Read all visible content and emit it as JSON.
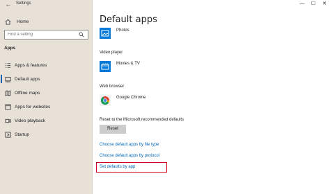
{
  "window": {
    "title": "Settings",
    "minimize": "—",
    "maximize": "☐",
    "close": "✕"
  },
  "sidebar": {
    "back_glyph": "←",
    "home_label": "Home",
    "search_placeholder": "Find a setting",
    "section_title": "Apps",
    "items": [
      {
        "label": "Apps & features",
        "icon": "list-icon"
      },
      {
        "label": "Default apps",
        "icon": "default-apps-icon",
        "active": true
      },
      {
        "label": "Offline maps",
        "icon": "map-icon"
      },
      {
        "label": "Apps for websites",
        "icon": "link-window-icon"
      },
      {
        "label": "Video playback",
        "icon": "video-icon"
      },
      {
        "label": "Startup",
        "icon": "startup-icon"
      }
    ]
  },
  "main": {
    "title": "Default apps",
    "photos_app": "Photos",
    "video_player_label": "Video player",
    "video_app": "Movies & TV",
    "web_browser_label": "Web browser",
    "browser_app": "Google Chrome",
    "reset_text": "Reset to the Microsoft recommended defaults",
    "reset_button": "Reset",
    "links": {
      "by_file_type": "Choose default apps by file type",
      "by_protocol": "Choose default apps by protocol",
      "by_app": "Set defaults by app"
    }
  },
  "colors": {
    "accent": "#0063b1",
    "sidebar_bg": "#e7e1d8",
    "highlight": "#d0021b"
  }
}
